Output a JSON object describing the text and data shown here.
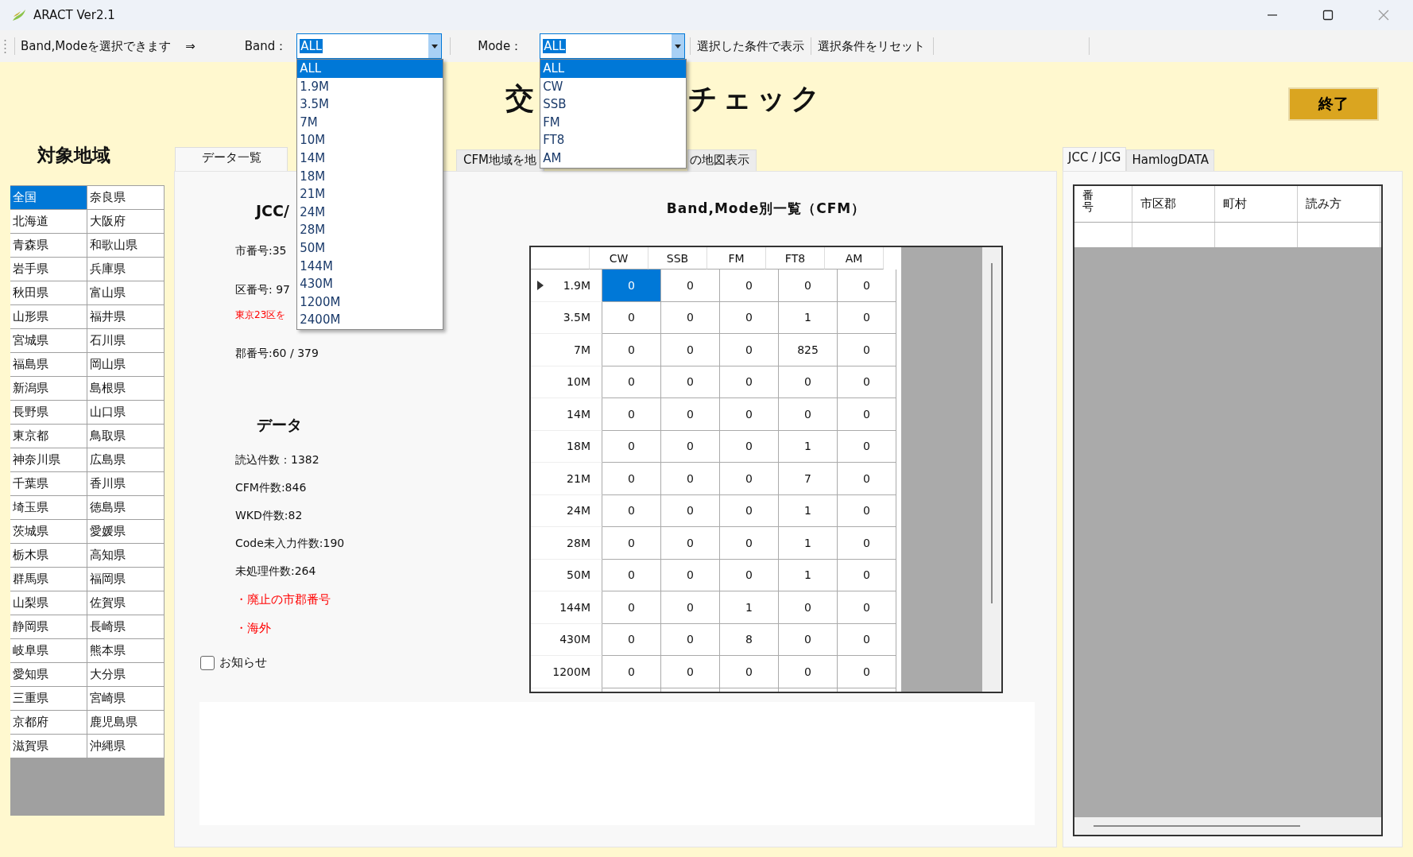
{
  "window": {
    "title": "ARACT Ver2.1"
  },
  "toolbar": {
    "hint": "Band,Modeを選択できます",
    "arrow": "⇒",
    "band": {
      "label": "Band：",
      "value": "ALL",
      "options": [
        {
          "label": "ALL",
          "selected": true
        },
        {
          "label": "1.9M",
          "selected": false
        },
        {
          "label": "3.5M",
          "selected": false
        },
        {
          "label": "7M",
          "selected": false
        },
        {
          "label": "10M",
          "selected": false
        },
        {
          "label": "14M",
          "selected": false
        },
        {
          "label": "18M",
          "selected": false
        },
        {
          "label": "21M",
          "selected": false
        },
        {
          "label": "24M",
          "selected": false
        },
        {
          "label": "28M",
          "selected": false
        },
        {
          "label": "50M",
          "selected": false
        },
        {
          "label": "144M",
          "selected": false
        },
        {
          "label": "430M",
          "selected": false
        },
        {
          "label": "1200M",
          "selected": false
        },
        {
          "label": "2400M",
          "selected": false
        }
      ]
    },
    "mode": {
      "label": "Mode：",
      "value": "ALL",
      "options": [
        {
          "label": "ALL",
          "selected": true
        },
        {
          "label": "CW",
          "selected": false
        },
        {
          "label": "SSB",
          "selected": false
        },
        {
          "label": "FM",
          "selected": false
        },
        {
          "label": "FT8",
          "selected": false
        },
        {
          "label": "AM",
          "selected": false
        }
      ]
    },
    "buttons": [
      "選択した条件で表示",
      "選択条件をリセット"
    ]
  },
  "title_parts": [
    "交",
    "チェック"
  ],
  "exit_button": "終了",
  "regions": {
    "heading": "対象地域",
    "items": [
      {
        "label": "全国",
        "selected": true
      },
      {
        "label": "北海道",
        "selected": false
      },
      {
        "label": "青森県",
        "selected": false
      },
      {
        "label": "岩手県",
        "selected": false
      },
      {
        "label": "秋田県",
        "selected": false
      },
      {
        "label": "山形県",
        "selected": false
      },
      {
        "label": "宮城県",
        "selected": false
      },
      {
        "label": "福島県",
        "selected": false
      },
      {
        "label": "新潟県",
        "selected": false
      },
      {
        "label": "長野県",
        "selected": false
      },
      {
        "label": "東京都",
        "selected": false
      },
      {
        "label": "神奈川県",
        "selected": false
      },
      {
        "label": "千葉県",
        "selected": false
      },
      {
        "label": "埼玉県",
        "selected": false
      },
      {
        "label": "茨城県",
        "selected": false
      },
      {
        "label": "栃木県",
        "selected": false
      },
      {
        "label": "群馬県",
        "selected": false
      },
      {
        "label": "山梨県",
        "selected": false
      },
      {
        "label": "静岡県",
        "selected": false
      },
      {
        "label": "岐阜県",
        "selected": false
      },
      {
        "label": "愛知県",
        "selected": false
      },
      {
        "label": "三重県",
        "selected": false
      },
      {
        "label": "京都府",
        "selected": false
      },
      {
        "label": "滋賀県",
        "selected": false
      },
      {
        "label": "奈良県",
        "selected": false
      },
      {
        "label": "大阪府",
        "selected": false
      },
      {
        "label": "和歌山県",
        "selected": false
      },
      {
        "label": "兵庫県",
        "selected": false
      },
      {
        "label": "富山県",
        "selected": false
      },
      {
        "label": "福井県",
        "selected": false
      },
      {
        "label": "石川県",
        "selected": false
      },
      {
        "label": "岡山県",
        "selected": false
      },
      {
        "label": "島根県",
        "selected": false
      },
      {
        "label": "山口県",
        "selected": false
      },
      {
        "label": "鳥取県",
        "selected": false
      },
      {
        "label": "広島県",
        "selected": false
      },
      {
        "label": "香川県",
        "selected": false
      },
      {
        "label": "徳島県",
        "selected": false
      },
      {
        "label": "愛媛県",
        "selected": false
      },
      {
        "label": "高知県",
        "selected": false
      },
      {
        "label": "福岡県",
        "selected": false
      },
      {
        "label": "佐賀県",
        "selected": false
      },
      {
        "label": "長崎県",
        "selected": false
      },
      {
        "label": "熊本県",
        "selected": false
      },
      {
        "label": "大分県",
        "selected": false
      },
      {
        "label": "宮崎県",
        "selected": false
      },
      {
        "label": "鹿児島県",
        "selected": false
      },
      {
        "label": "沖縄県",
        "selected": false
      }
    ]
  },
  "center_tabs": [
    {
      "label": "データ一覧",
      "selected": true
    },
    {
      "label": "CFM地域を地",
      "selected": false
    },
    {
      "label": "の地図表示",
      "selected": false
    }
  ],
  "jcc": {
    "heading": "JCC/",
    "lines": [
      {
        "text": "市番号:35",
        "kind": "plain"
      },
      {
        "text": "区番号: 97",
        "kind": "plain"
      },
      {
        "text": "東京23区を",
        "kind": "warning"
      },
      {
        "text": "郡番号:60 / 379",
        "kind": "plain"
      }
    ]
  },
  "data": {
    "heading": "データ",
    "lines": [
      {
        "text": "読込件数：1382",
        "kind": "plain"
      },
      {
        "text": "CFM件数:846",
        "kind": "plain"
      },
      {
        "text": "WKD件数:82",
        "kind": "plain"
      },
      {
        "text": "Code未入力件数:190",
        "kind": "plain"
      },
      {
        "text": "未処理件数:264",
        "kind": "plain"
      },
      {
        "text": "・廃止の市郡番号",
        "kind": "alert"
      },
      {
        "text": "・海外",
        "kind": "alert"
      }
    ]
  },
  "notice": {
    "label": "お知らせ",
    "checked": false
  },
  "cfm_table": {
    "title": "Band,Mode別一覧（CFM）",
    "columns": [
      "CW",
      "SSB",
      "FM",
      "FT8",
      "AM"
    ],
    "rows": [
      {
        "band": "1.9M",
        "current": true,
        "cells": [
          {
            "value": "0",
            "selected": true
          },
          {
            "value": "0",
            "selected": false
          },
          {
            "value": "0",
            "selected": false
          },
          {
            "value": "0",
            "selected": false
          },
          {
            "value": "0",
            "selected": false
          }
        ]
      },
      {
        "band": "3.5M",
        "current": false,
        "cells": [
          {
            "value": "0",
            "selected": false
          },
          {
            "value": "0",
            "selected": false
          },
          {
            "value": "0",
            "selected": false
          },
          {
            "value": "1",
            "selected": false
          },
          {
            "value": "0",
            "selected": false
          }
        ]
      },
      {
        "band": "7M",
        "current": false,
        "cells": [
          {
            "value": "0",
            "selected": false
          },
          {
            "value": "0",
            "selected": false
          },
          {
            "value": "0",
            "selected": false
          },
          {
            "value": "825",
            "selected": false
          },
          {
            "value": "0",
            "selected": false
          }
        ]
      },
      {
        "band": "10M",
        "current": false,
        "cells": [
          {
            "value": "0",
            "selected": false
          },
          {
            "value": "0",
            "selected": false
          },
          {
            "value": "0",
            "selected": false
          },
          {
            "value": "0",
            "selected": false
          },
          {
            "value": "0",
            "selected": false
          }
        ]
      },
      {
        "band": "14M",
        "current": false,
        "cells": [
          {
            "value": "0",
            "selected": false
          },
          {
            "value": "0",
            "selected": false
          },
          {
            "value": "0",
            "selected": false
          },
          {
            "value": "0",
            "selected": false
          },
          {
            "value": "0",
            "selected": false
          }
        ]
      },
      {
        "band": "18M",
        "current": false,
        "cells": [
          {
            "value": "0",
            "selected": false
          },
          {
            "value": "0",
            "selected": false
          },
          {
            "value": "0",
            "selected": false
          },
          {
            "value": "1",
            "selected": false
          },
          {
            "value": "0",
            "selected": false
          }
        ]
      },
      {
        "band": "21M",
        "current": false,
        "cells": [
          {
            "value": "0",
            "selected": false
          },
          {
            "value": "0",
            "selected": false
          },
          {
            "value": "0",
            "selected": false
          },
          {
            "value": "7",
            "selected": false
          },
          {
            "value": "0",
            "selected": false
          }
        ]
      },
      {
        "band": "24M",
        "current": false,
        "cells": [
          {
            "value": "0",
            "selected": false
          },
          {
            "value": "0",
            "selected": false
          },
          {
            "value": "0",
            "selected": false
          },
          {
            "value": "1",
            "selected": false
          },
          {
            "value": "0",
            "selected": false
          }
        ]
      },
      {
        "band": "28M",
        "current": false,
        "cells": [
          {
            "value": "0",
            "selected": false
          },
          {
            "value": "0",
            "selected": false
          },
          {
            "value": "0",
            "selected": false
          },
          {
            "value": "1",
            "selected": false
          },
          {
            "value": "0",
            "selected": false
          }
        ]
      },
      {
        "band": "50M",
        "current": false,
        "cells": [
          {
            "value": "0",
            "selected": false
          },
          {
            "value": "0",
            "selected": false
          },
          {
            "value": "0",
            "selected": false
          },
          {
            "value": "1",
            "selected": false
          },
          {
            "value": "0",
            "selected": false
          }
        ]
      },
      {
        "band": "144M",
        "current": false,
        "cells": [
          {
            "value": "0",
            "selected": false
          },
          {
            "value": "0",
            "selected": false
          },
          {
            "value": "1",
            "selected": false
          },
          {
            "value": "0",
            "selected": false
          },
          {
            "value": "0",
            "selected": false
          }
        ]
      },
      {
        "band": "430M",
        "current": false,
        "cells": [
          {
            "value": "0",
            "selected": false
          },
          {
            "value": "0",
            "selected": false
          },
          {
            "value": "8",
            "selected": false
          },
          {
            "value": "0",
            "selected": false
          },
          {
            "value": "0",
            "selected": false
          }
        ]
      },
      {
        "band": "1200M",
        "current": false,
        "cells": [
          {
            "value": "0",
            "selected": false
          },
          {
            "value": "0",
            "selected": false
          },
          {
            "value": "0",
            "selected": false
          },
          {
            "value": "0",
            "selected": false
          },
          {
            "value": "0",
            "selected": false
          }
        ]
      }
    ]
  },
  "right_tabs": [
    {
      "label": "JCC / JCG",
      "selected": true
    },
    {
      "label": "HamlogDATA",
      "selected": false
    }
  ],
  "jcc_table": {
    "columns": [
      "番号",
      "市区郡",
      "町村",
      "読み方"
    ]
  }
}
